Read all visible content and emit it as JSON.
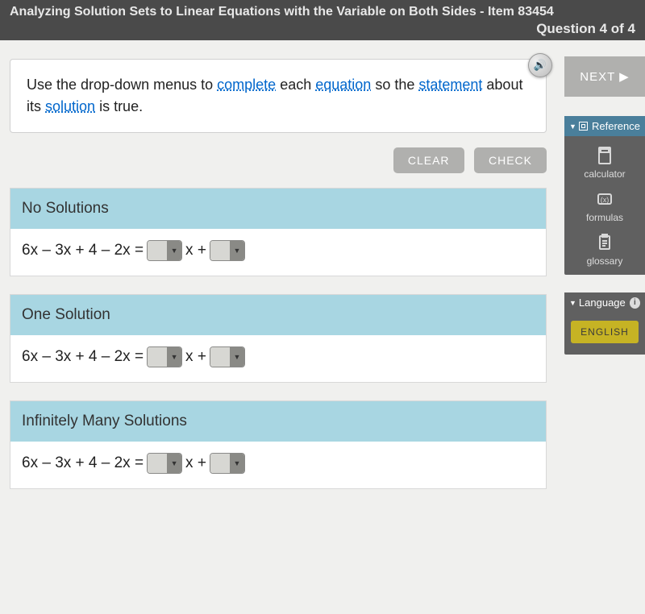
{
  "header": {
    "title": "Analyzing Solution Sets to Linear Equations with the Variable on Both Sides - Item 83454",
    "progress": "Question 4 of 4"
  },
  "instruction": {
    "pre": "Use the drop-down menus to ",
    "t1": "complete",
    "mid1": " each ",
    "t2": "equation",
    "mid2": " so the ",
    "t3": "statement",
    "mid3": " about its ",
    "t4": "solution",
    "post": " is true."
  },
  "buttons": {
    "clear": "CLEAR",
    "check": "CHECK"
  },
  "sections": [
    {
      "title": "No Solutions",
      "lhs": "6x – 3x + 4 – 2x =",
      "mid": "x +"
    },
    {
      "title": "One Solution",
      "lhs": "6x – 3x + 4 – 2x =",
      "mid": "x +"
    },
    {
      "title": "Infinitely Many Solutions",
      "lhs": "6x – 3x + 4 – 2x =",
      "mid": "x +"
    }
  ],
  "rail": {
    "next": "NEXT",
    "reference": {
      "label": "Reference",
      "tools": [
        "calculator",
        "formulas",
        "glossary"
      ]
    },
    "language": {
      "label": "Language",
      "current": "ENGLISH"
    }
  }
}
